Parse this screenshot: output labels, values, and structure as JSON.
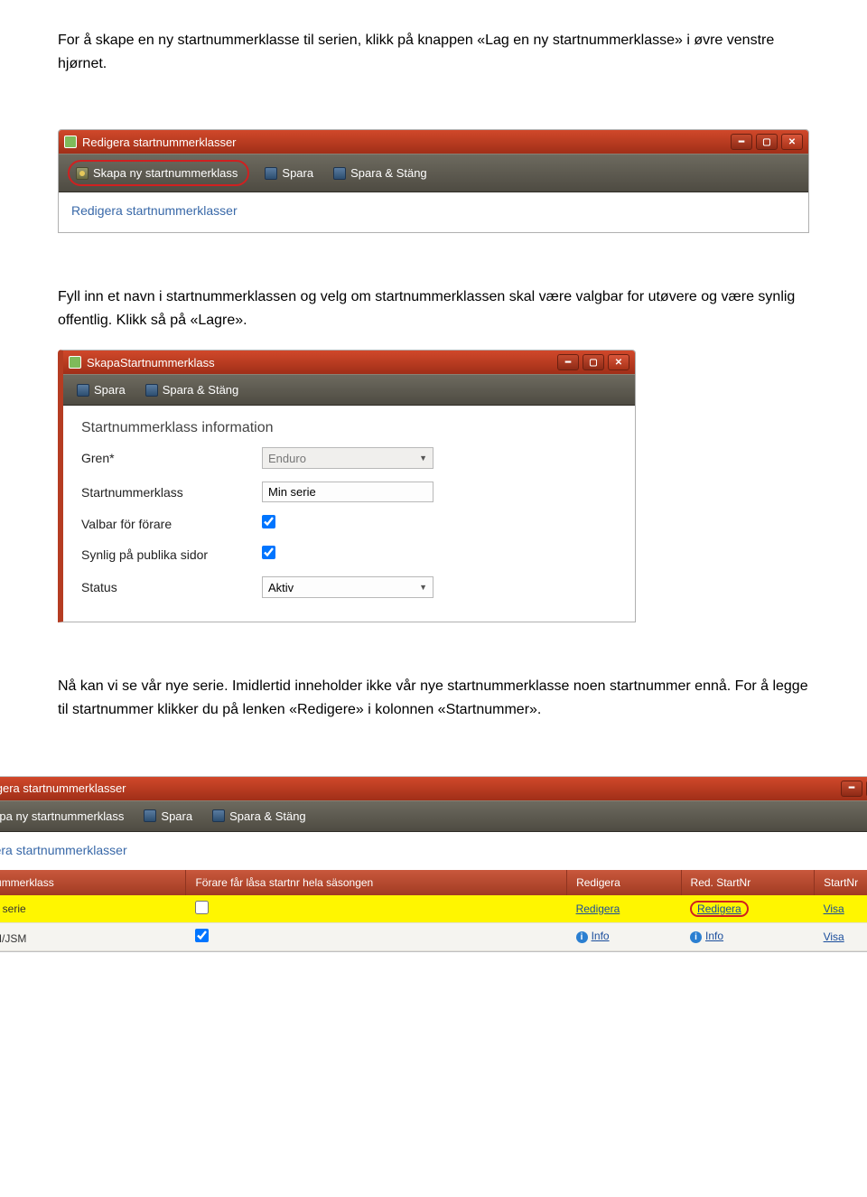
{
  "para1": "For å skape en ny startnummerklasse til serien, klikk på knappen «Lag en ny startnummerklasse» i øvre venstre hjørnet.",
  "para2": "Fyll inn et navn i startnummerklassen og velg om startnummerklassen skal være valgbar for utøvere og være synlig offentlig. Klikk så på «Lagre».",
  "para3": "Nå kan vi se vår nye serie. Imidlertid inneholder ikke vår nye startnummerklasse noen startnummer ennå. For å legge til startnummer klikker du på lenken «Redigere» i kolonnen «Startnummer».",
  "win1": {
    "title": "Redigera startnummerklasser",
    "tb_new": "Skapa ny startnummerklass",
    "tb_save": "Spara",
    "tb_saveclose": "Spara & Stäng",
    "subheader": "Redigera startnummerklasser"
  },
  "win2": {
    "title": "SkapaStartnummerklass",
    "tb_save": "Spara",
    "tb_saveclose": "Spara & Stäng",
    "form_title": "Startnummerklass information",
    "f_gren_label": "Gren*",
    "f_gren_value": "Enduro",
    "f_name_label": "Startnummerklass",
    "f_name_value": "Min serie",
    "f_valbar_label": "Valbar för förare",
    "f_synlig_label": "Synlig på publika sidor",
    "f_status_label": "Status",
    "f_status_value": "Aktiv"
  },
  "win3": {
    "title": "Redigera startnummerklasser",
    "tb_new": "Skapa ny startnummerklass",
    "tb_save": "Spara",
    "tb_saveclose": "Spara & Stäng",
    "subheader": "Redigera startnummerklasser",
    "th": {
      "c1": "Startnummerklass",
      "c2": "Förare får låsa startnr hela säsongen",
      "c3": "Redigera",
      "c4": "Red. StartNr",
      "c5": "StartNr"
    },
    "rows": [
      {
        "name": "Min serie",
        "lock": false,
        "redigera": "Redigera",
        "redStart": "Redigera",
        "startNr": "Visa",
        "info": false,
        "highlight": true
      },
      {
        "name": "SM/JSM",
        "lock": true,
        "redigera": "Info",
        "redStart": "Info",
        "startNr": "Visa",
        "info": true,
        "highlight": false
      }
    ]
  }
}
